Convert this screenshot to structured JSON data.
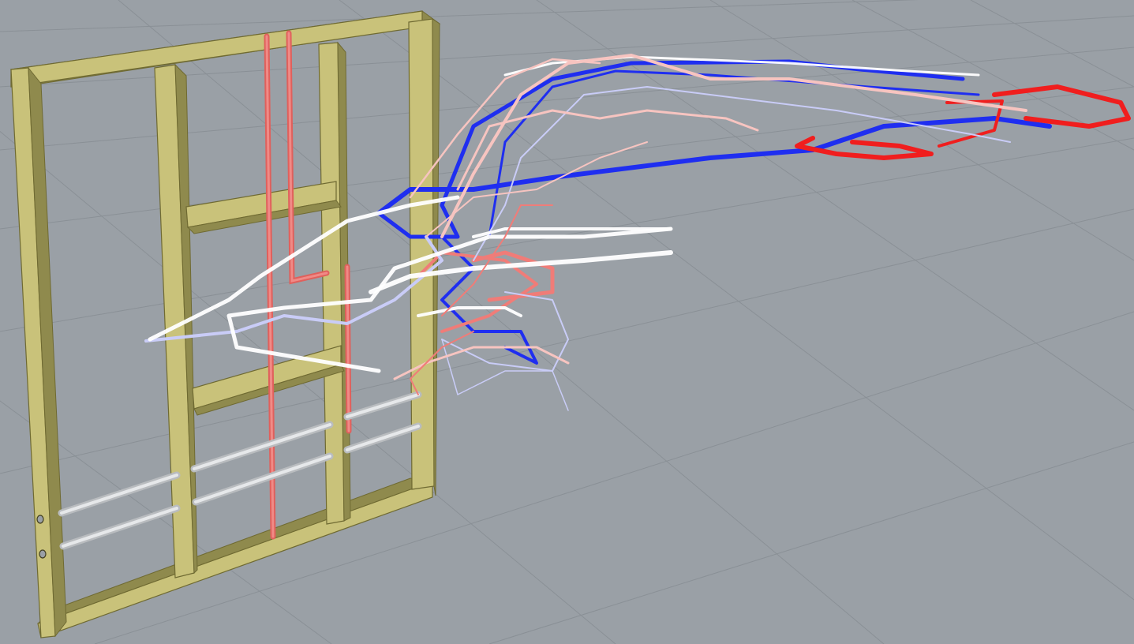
{
  "scene": {
    "background_color": "#9aa0a6",
    "grid_color": "#8a9096",
    "frame_color": "#c9c27a",
    "frame_shadow_color": "#8f8a4d",
    "conduit_red": "#e0605c",
    "pipe_grey": "#c8cbce"
  },
  "trajectories": {
    "palette": [
      "#1f2ef0",
      "#c9ccf7",
      "#ffffff",
      "#f7c4c0",
      "#f07c78",
      "#f01e1e"
    ],
    "series_count": 16
  }
}
